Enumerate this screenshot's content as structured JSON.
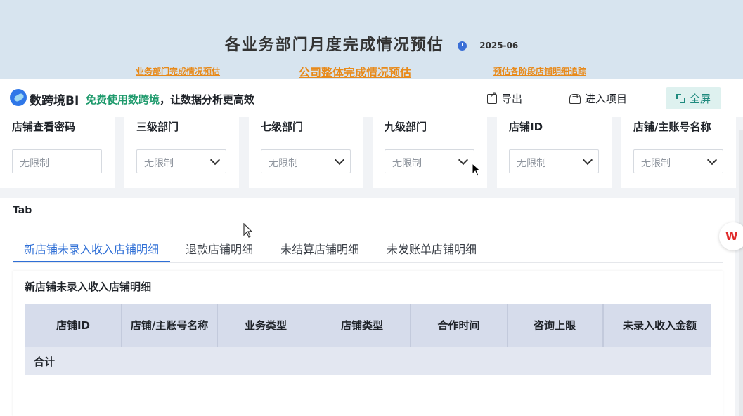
{
  "banner": {
    "title": "各业务部门月度完成情况预估",
    "date": "2025-06",
    "nav_left": "业务部门完成情况预估",
    "nav_center": "公司整体完成情况预估",
    "nav_right": "预估各阶段店铺明细追踪"
  },
  "toolbar": {
    "logo_text": "数跨境BI",
    "slogan_highlight": "免费使用数跨境",
    "slogan_rest": "，让数据分析更高效",
    "export_label": "导出",
    "enter_label": "进入项目",
    "fullscreen_label": "全屏"
  },
  "filters": [
    {
      "label": "店铺查看密码",
      "placeholder": "无限制"
    },
    {
      "label": "三级部门",
      "placeholder": "无限制"
    },
    {
      "label": "七级部门",
      "placeholder": "无限制"
    },
    {
      "label": "九级部门",
      "placeholder": "无限制"
    },
    {
      "label": "店铺ID",
      "placeholder": "无限制"
    },
    {
      "label": "店铺/主账号名称",
      "placeholder": "无限制"
    }
  ],
  "tabs": {
    "section_title": "Tab",
    "items": [
      "新店铺未录入收入店铺明细",
      "退款店铺明细",
      "未结算店铺明细",
      "未发账单店铺明细"
    ],
    "active_index": 0
  },
  "panel": {
    "title": "新店铺未录入收入店铺明细",
    "columns": [
      "店铺ID",
      "店铺/主账号名称",
      "业务类型",
      "店铺类型",
      "合作时间",
      "咨询上限",
      "未录入收入金额"
    ],
    "total_row_label": "合计"
  },
  "floating": {
    "wps_label": "W"
  },
  "colors": {
    "accent": "#2f6fd6",
    "nav_link": "#e88a1a",
    "brand_green": "#1e9a6c",
    "table_header": "#d6dceb"
  }
}
